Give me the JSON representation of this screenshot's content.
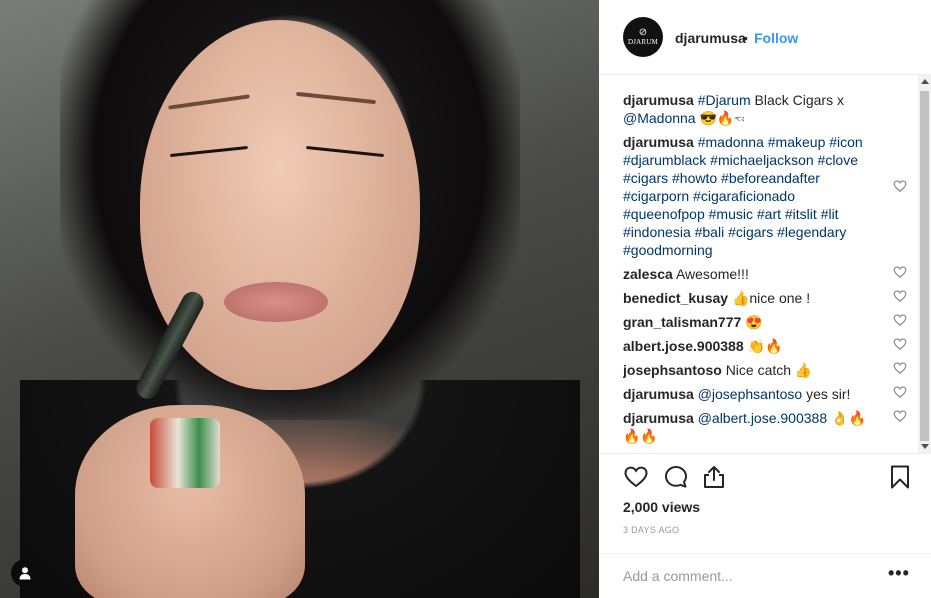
{
  "post": {
    "account": "djarumusa",
    "separator": "•",
    "follow_label": "Follow",
    "logo_text": "DJARUM"
  },
  "comments": [
    {
      "author": "djarumusa",
      "parts": [
        {
          "t": "link",
          "v": "#Djarum"
        },
        {
          "t": "text",
          "v": " Black Cigars x "
        },
        {
          "t": "link",
          "v": "@Madonna"
        },
        {
          "t": "text",
          "v": " 😎🔥🖘"
        }
      ],
      "heart": false
    },
    {
      "author": "djarumusa",
      "parts": [
        {
          "t": "link",
          "v": "#madonna #makeup #icon #djarumblack #michaeljackson #clove #cigars #howto #beforeandafter #cigarporn #cigaraficionado #queenofpop #music #art #itslit #lit #indonesia #bali #cigars #legendary #goodmorning"
        }
      ],
      "heart": true
    },
    {
      "author": "zalesca",
      "parts": [
        {
          "t": "text",
          "v": "Awesome!!!"
        }
      ],
      "heart": true
    },
    {
      "author": "benedict_kusay",
      "parts": [
        {
          "t": "text",
          "v": "👍nice one !"
        }
      ],
      "heart": true
    },
    {
      "author": "gran_talisman777",
      "parts": [
        {
          "t": "text",
          "v": "😍"
        }
      ],
      "heart": true
    },
    {
      "author": "albert.jose.900388",
      "parts": [
        {
          "t": "text",
          "v": "👏🔥"
        }
      ],
      "heart": true
    },
    {
      "author": "josephsantoso",
      "parts": [
        {
          "t": "text",
          "v": "Nice catch 👍"
        }
      ],
      "heart": true
    },
    {
      "author": "djarumusa",
      "parts": [
        {
          "t": "link",
          "v": "@josephsantoso"
        },
        {
          "t": "text",
          "v": " yes sir!"
        }
      ],
      "heart": true
    },
    {
      "author": "djarumusa",
      "parts": [
        {
          "t": "link",
          "v": "@albert.jose.900388"
        },
        {
          "t": "text",
          "v": " 👌🔥🔥🔥"
        }
      ],
      "heart": true
    }
  ],
  "stats": {
    "views": "2,000 views",
    "age": "3 DAYS AGO"
  },
  "composer": {
    "placeholder": "Add a comment...",
    "more_label": "•••"
  },
  "icons": {
    "like": "heart-icon",
    "comment": "comment-icon",
    "share": "share-icon",
    "save": "bookmark-icon",
    "profile": "user-icon"
  },
  "colors": {
    "link": "#003569",
    "follow": "#3897f0",
    "muted": "#999999"
  }
}
